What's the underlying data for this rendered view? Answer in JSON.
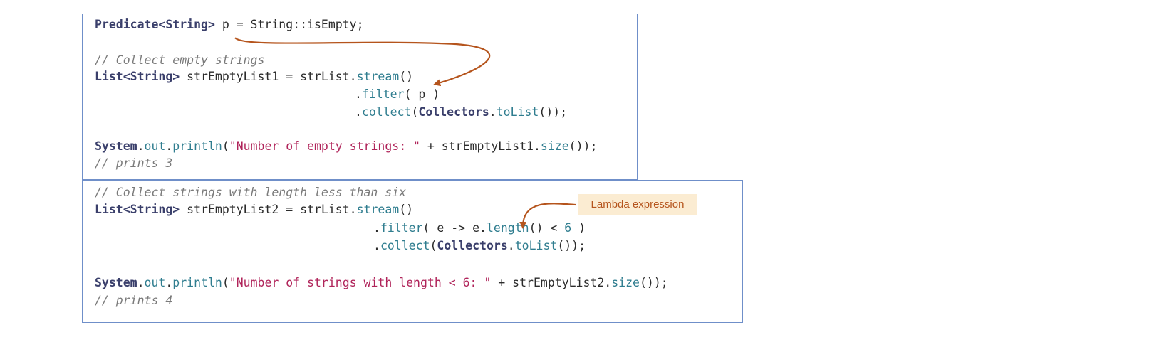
{
  "box1": {
    "l1": {
      "a": "Predicate<String>",
      "b": " p = String::isEmpty;"
    },
    "l2": {
      "a": "// Collect empty strings"
    },
    "l3": {
      "a": "List<String>",
      "b": " strEmptyList1 = strList.",
      "c": "stream",
      "d": "()"
    },
    "l4": {
      "a": ".",
      "b": "filter",
      "c": "( p )"
    },
    "l5": {
      "a": ".",
      "b": "collect",
      "c": "(",
      "d": "Collectors",
      "e": ".",
      "f": "toList",
      "g": "());"
    },
    "l6": {
      "a": "System",
      "b": ".",
      "c": "out",
      "d": ".",
      "e": "println",
      "f": "(",
      "g": "\"Number of empty strings: \"",
      "h": " + strEmptyList1.",
      "i": "size",
      "j": "());"
    },
    "l7": {
      "a": "// prints 3"
    }
  },
  "box2": {
    "l1": {
      "a": "// Collect strings with length less than six"
    },
    "l2": {
      "a": "List<String>",
      "b": " strEmptyList2 = strList.",
      "c": "stream",
      "d": "()"
    },
    "l3": {
      "a": ".",
      "b": "filter",
      "c": "( e -> e.",
      "d": "length",
      "e": "() < ",
      "f": "6",
      "g": " )"
    },
    "l4": {
      "a": ".",
      "b": "collect",
      "c": "(",
      "d": "Collectors",
      "e": ".",
      "f": "toList",
      "g": "());"
    },
    "l5": {
      "a": "System",
      "b": ".",
      "c": "out",
      "d": ".",
      "e": "println",
      "f": "(",
      "g": "\"Number of strings with length < 6: \"",
      "h": " + strEmptyList2.",
      "i": "size",
      "j": "());"
    },
    "l6": {
      "a": "// prints 4"
    }
  },
  "callout": {
    "label": "Lambda expression"
  },
  "colors": {
    "arrow": "#b5541c",
    "border": "#6f8fc9",
    "callout_bg": "#fbecd2"
  },
  "icons": [
    "curved-arrow-icon",
    "curved-arrow-icon"
  ]
}
